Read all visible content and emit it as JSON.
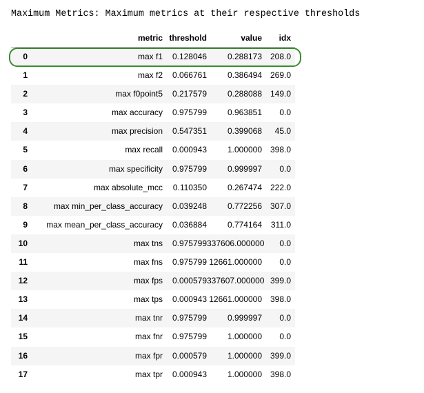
{
  "title": "Maximum Metrics: Maximum metrics at their respective thresholds",
  "columns": {
    "index": "",
    "metric": "metric",
    "threshold": "threshold",
    "value": "value",
    "idx": "idx"
  },
  "rows": [
    {
      "index": "0",
      "metric": "max f1",
      "threshold": "0.128046",
      "value": "0.288173",
      "idx": "208.0"
    },
    {
      "index": "1",
      "metric": "max f2",
      "threshold": "0.066761",
      "value": "0.386494",
      "idx": "269.0"
    },
    {
      "index": "2",
      "metric": "max f0point5",
      "threshold": "0.217579",
      "value": "0.288088",
      "idx": "149.0"
    },
    {
      "index": "3",
      "metric": "max accuracy",
      "threshold": "0.975799",
      "value": "0.963851",
      "idx": "0.0"
    },
    {
      "index": "4",
      "metric": "max precision",
      "threshold": "0.547351",
      "value": "0.399068",
      "idx": "45.0"
    },
    {
      "index": "5",
      "metric": "max recall",
      "threshold": "0.000943",
      "value": "1.000000",
      "idx": "398.0"
    },
    {
      "index": "6",
      "metric": "max specificity",
      "threshold": "0.975799",
      "value": "0.999997",
      "idx": "0.0"
    },
    {
      "index": "7",
      "metric": "max absolute_mcc",
      "threshold": "0.110350",
      "value": "0.267474",
      "idx": "222.0"
    },
    {
      "index": "8",
      "metric": "max min_per_class_accuracy",
      "threshold": "0.039248",
      "value": "0.772256",
      "idx": "307.0"
    },
    {
      "index": "9",
      "metric": "max mean_per_class_accuracy",
      "threshold": "0.036884",
      "value": "0.774164",
      "idx": "311.0"
    },
    {
      "index": "10",
      "metric": "max tns",
      "threshold": "0.975799",
      "value": "337606.000000",
      "idx": "0.0"
    },
    {
      "index": "11",
      "metric": "max fns",
      "threshold": "0.975799",
      "value": "12661.000000",
      "idx": "0.0"
    },
    {
      "index": "12",
      "metric": "max fps",
      "threshold": "0.000579",
      "value": "337607.000000",
      "idx": "399.0"
    },
    {
      "index": "13",
      "metric": "max tps",
      "threshold": "0.000943",
      "value": "12661.000000",
      "idx": "398.0"
    },
    {
      "index": "14",
      "metric": "max tnr",
      "threshold": "0.975799",
      "value": "0.999997",
      "idx": "0.0"
    },
    {
      "index": "15",
      "metric": "max fnr",
      "threshold": "0.975799",
      "value": "1.000000",
      "idx": "0.0"
    },
    {
      "index": "16",
      "metric": "max fpr",
      "threshold": "0.000579",
      "value": "1.000000",
      "idx": "399.0"
    },
    {
      "index": "17",
      "metric": "max tpr",
      "threshold": "0.000943",
      "value": "1.000000",
      "idx": "398.0"
    }
  ],
  "highlighted_row": "0",
  "colors": {
    "highlight_border": "#3a8a2e",
    "stripe": "#f5f5f5"
  }
}
